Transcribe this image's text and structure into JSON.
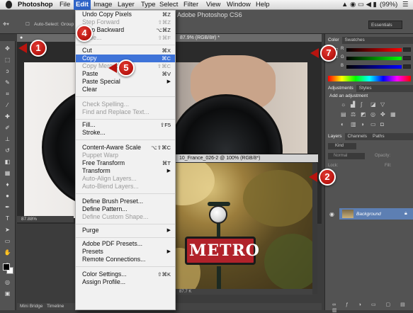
{
  "menubar": {
    "app": "Photoshop",
    "items": [
      "File",
      "Edit",
      "Image",
      "Layer",
      "Type",
      "Select",
      "Filter",
      "View",
      "Window",
      "Help"
    ],
    "battery": "(99%)"
  },
  "window_title": "Adobe Photoshop CS6",
  "options": {
    "auto_select": "Auto-Select:",
    "group": "Group",
    "workspace": "Essentials"
  },
  "doc1": {
    "tab": "87.9% (RGB/8#) *",
    "status": "87.88%"
  },
  "doc2": {
    "tab": "10_France_026-2 @ 100% (RGB/8*)",
    "status": "87.7 K",
    "sign": "METRO"
  },
  "edit_menu": {
    "items": [
      {
        "label": "Undo Copy Pixels",
        "shortcut": "⌘Z",
        "disabled": false
      },
      {
        "label": "Step Forward",
        "shortcut": "⇧⌘Z",
        "disabled": true
      },
      {
        "label": "Step Backward",
        "shortcut": "⌥⌘Z",
        "disabled": false
      },
      {
        "label": "Fade...",
        "shortcut": "⇧⌘F",
        "disabled": true
      },
      {
        "label": "Cut",
        "shortcut": "⌘X",
        "disabled": false
      },
      {
        "label": "Copy",
        "shortcut": "⌘C",
        "disabled": false
      },
      {
        "label": "Copy Merged",
        "shortcut": "⇧⌘C",
        "disabled": true
      },
      {
        "label": "Paste",
        "shortcut": "⌘V",
        "disabled": false
      },
      {
        "label": "Paste Special",
        "shortcut": "▶",
        "disabled": false
      },
      {
        "label": "Clear",
        "shortcut": "",
        "disabled": false
      },
      {
        "label": "Check Spelling...",
        "shortcut": "",
        "disabled": true
      },
      {
        "label": "Find and Replace Text...",
        "shortcut": "",
        "disabled": true
      },
      {
        "label": "Fill...",
        "shortcut": "⇧F5",
        "disabled": false
      },
      {
        "label": "Stroke...",
        "shortcut": "",
        "disabled": false
      },
      {
        "label": "Content-Aware Scale",
        "shortcut": "⌥⇧⌘C",
        "disabled": false
      },
      {
        "label": "Puppet Warp",
        "shortcut": "",
        "disabled": true
      },
      {
        "label": "Free Transform",
        "shortcut": "⌘T",
        "disabled": false
      },
      {
        "label": "Transform",
        "shortcut": "▶",
        "disabled": false
      },
      {
        "label": "Auto-Align Layers...",
        "shortcut": "",
        "disabled": true
      },
      {
        "label": "Auto-Blend Layers...",
        "shortcut": "",
        "disabled": true
      },
      {
        "label": "Define Brush Preset...",
        "shortcut": "",
        "disabled": false
      },
      {
        "label": "Define Pattern...",
        "shortcut": "",
        "disabled": false
      },
      {
        "label": "Define Custom Shape...",
        "shortcut": "",
        "disabled": true
      },
      {
        "label": "Purge",
        "shortcut": "▶",
        "disabled": false
      },
      {
        "label": "Adobe PDF Presets...",
        "shortcut": "",
        "disabled": false
      },
      {
        "label": "Presets",
        "shortcut": "▶",
        "disabled": false
      },
      {
        "label": "Remote Connections...",
        "shortcut": "",
        "disabled": false
      },
      {
        "label": "Color Settings...",
        "shortcut": "⇧⌘K",
        "disabled": false
      },
      {
        "label": "Assign Profile...",
        "shortcut": "",
        "disabled": false
      }
    ]
  },
  "panels": {
    "color_tabs": [
      "Color",
      "Swatches"
    ],
    "channels": [
      "R",
      "G",
      "B"
    ],
    "adjust_tabs": [
      "Adjustments",
      "Styles"
    ],
    "add_adjustment": "Add an adjustment",
    "layer_tabs": [
      "Layers",
      "Channels",
      "Paths"
    ],
    "kind": "Kind",
    "blend_mode": "Normal",
    "opacity_label": "Opacity:",
    "fill_label": "Fill:",
    "lock_label": "Lock:",
    "layer_name": "Background"
  },
  "bottom_tabs": [
    "Mini Bridge",
    "Timeline"
  ],
  "callouts": [
    "1",
    "2",
    "4",
    "5",
    "7"
  ]
}
